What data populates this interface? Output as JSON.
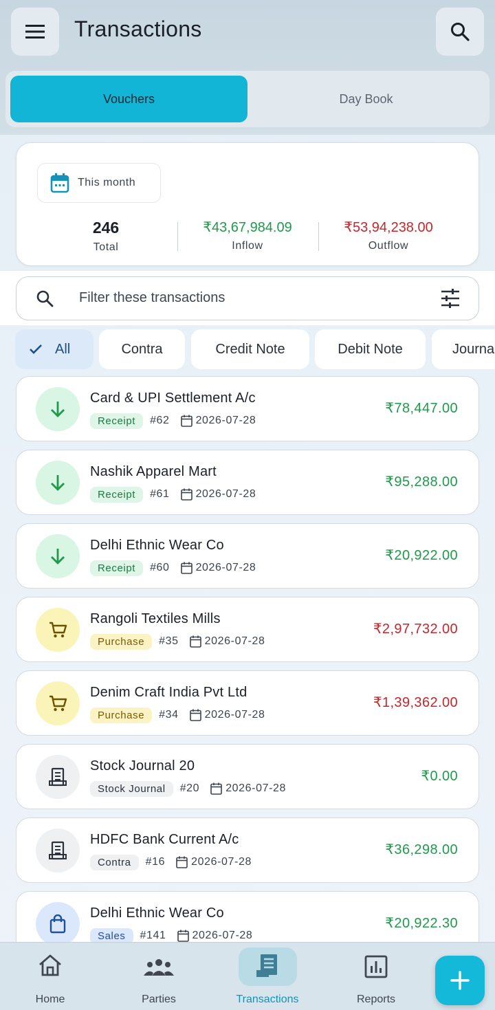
{
  "header": {
    "title": "Transactions",
    "tabs": [
      {
        "label": "Vouchers",
        "active": true
      },
      {
        "label": "Day Book",
        "active": false
      }
    ]
  },
  "summary": {
    "period": "This month",
    "total_value": "246",
    "total_label": "Total",
    "inflow_value": "₹43,67,984.09",
    "inflow_label": "Inflow",
    "outflow_value": "₹53,94,238.00",
    "outflow_label": "Outflow"
  },
  "filter": {
    "placeholder": "Filter these transactions"
  },
  "chips": [
    {
      "label": "All",
      "active": true
    },
    {
      "label": "Contra",
      "active": false
    },
    {
      "label": "Credit Note",
      "active": false
    },
    {
      "label": "Debit Note",
      "active": false
    },
    {
      "label": "Journal",
      "active": false
    }
  ],
  "transactions": [
    {
      "name": "Card & UPI Settlement A/c",
      "type": "Receipt",
      "number": "#62",
      "date": "2026-07-28",
      "amount": "₹78,447.00",
      "icon": "arrow-down-icon",
      "direction": "in"
    },
    {
      "name": "Nashik Apparel Mart",
      "type": "Receipt",
      "number": "#61",
      "date": "2026-07-28",
      "amount": "₹95,288.00",
      "icon": "arrow-down-icon",
      "direction": "in"
    },
    {
      "name": "Delhi Ethnic Wear Co",
      "type": "Receipt",
      "number": "#60",
      "date": "2026-07-28",
      "amount": "₹20,922.00",
      "icon": "arrow-down-icon",
      "direction": "in"
    },
    {
      "name": "Rangoli Textiles Mills",
      "type": "Purchase",
      "number": "#35",
      "date": "2026-07-28",
      "amount": "₹2,97,732.00",
      "icon": "cart-icon",
      "direction": "out"
    },
    {
      "name": "Denim Craft India Pvt Ltd",
      "type": "Purchase",
      "number": "#34",
      "date": "2026-07-28",
      "amount": "₹1,39,362.00",
      "icon": "cart-icon",
      "direction": "out"
    },
    {
      "name": "Stock Journal 20",
      "type": "Stock Journal",
      "number": "#20",
      "date": "2026-07-28",
      "amount": "₹0.00",
      "icon": "receipt-icon",
      "direction": "in"
    },
    {
      "name": "HDFC Bank Current A/c",
      "type": "Contra",
      "number": "#16",
      "date": "2026-07-28",
      "amount": "₹36,298.00",
      "icon": "receipt-icon",
      "direction": "in"
    },
    {
      "name": "Delhi Ethnic Wear Co",
      "type": "Sales",
      "number": "#141",
      "date": "2026-07-28",
      "amount": "₹20,922.30",
      "icon": "shopping-bag-icon",
      "direction": "in"
    }
  ],
  "bottom_nav": [
    {
      "label": "Home",
      "icon": "home-icon",
      "active": false
    },
    {
      "label": "Parties",
      "icon": "people-icon",
      "active": false
    },
    {
      "label": "Transactions",
      "icon": "transactions-icon",
      "active": true
    },
    {
      "label": "Reports",
      "icon": "reports-icon",
      "active": false
    }
  ],
  "colors": {
    "accent": "#14b8d8",
    "inflow": "#1f9a4b",
    "outflow": "#c6262b"
  }
}
